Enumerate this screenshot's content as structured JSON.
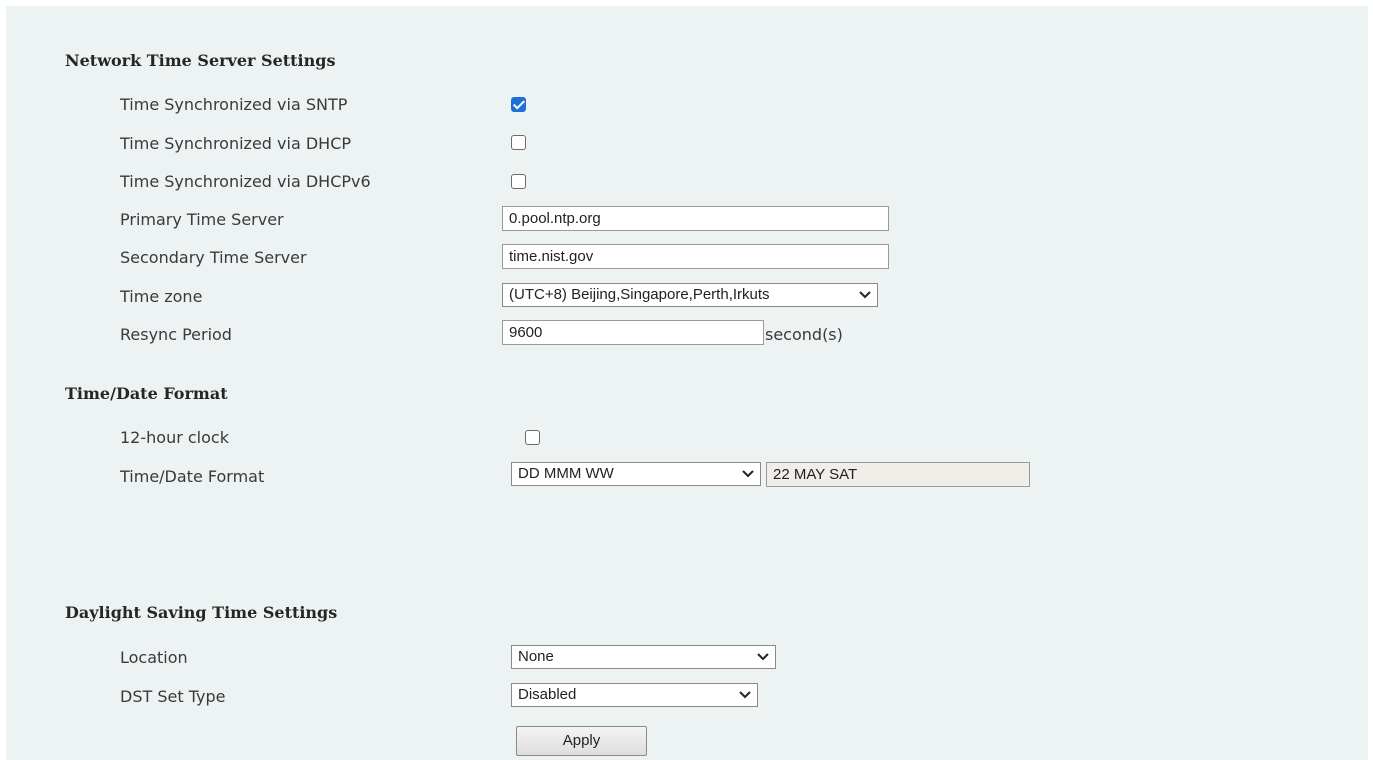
{
  "network_time": {
    "heading": "Network Time Server Settings",
    "sntp": {
      "label": "Time Synchronized via SNTP",
      "checked": true
    },
    "dhcp": {
      "label": "Time Synchronized via DHCP",
      "checked": false
    },
    "dhcpv6": {
      "label": "Time Synchronized via DHCPv6",
      "checked": false
    },
    "primary_server": {
      "label": "Primary Time Server",
      "value": "0.pool.ntp.org"
    },
    "secondary_server": {
      "label": "Secondary Time Server",
      "value": "time.nist.gov"
    },
    "timezone": {
      "label": "Time zone",
      "selected": "(UTC+8) Beijing,Singapore,Perth,Irkuts"
    },
    "resync": {
      "label": "Resync Period",
      "value": "9600",
      "unit": "second(s)"
    }
  },
  "time_date_format": {
    "heading": "Time/Date Format",
    "twelve_hour": {
      "label": "12-hour clock",
      "checked": false
    },
    "format": {
      "label": "Time/Date Format",
      "selected": "DD MMM WW",
      "preview": "22 MAY SAT"
    }
  },
  "dst": {
    "heading": "Daylight Saving Time Settings",
    "location": {
      "label": "Location",
      "selected": "None"
    },
    "set_type": {
      "label": "DST Set Type",
      "selected": "Disabled"
    }
  },
  "apply_label": "Apply",
  "colors": {
    "panel_background": "#edf2f3",
    "checkbox_checked": "#1f6fd6",
    "readonly_field": "#f1eeea"
  },
  "icons": {
    "checkbox": "checkbox-icon",
    "dropdown": "chevron-down-icon"
  }
}
